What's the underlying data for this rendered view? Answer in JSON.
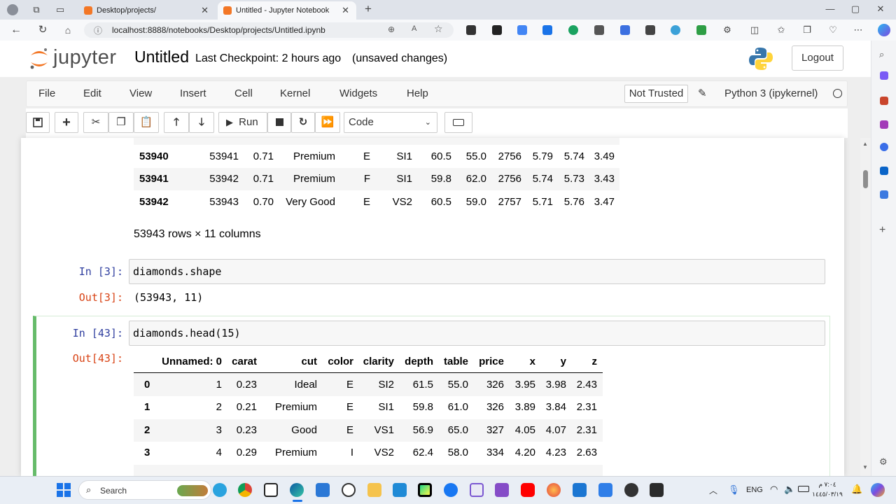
{
  "browser": {
    "tabs": [
      {
        "title": "Desktop/projects/",
        "active": false
      },
      {
        "title": "Untitled - Jupyter Notebook",
        "active": true
      }
    ],
    "url": "localhost:8888/notebooks/Desktop/projects/Untitled.ipynb"
  },
  "jupyter": {
    "logo_text": "jupyter",
    "notebook_name": "Untitled",
    "checkpoint": "Last Checkpoint: 2 hours ago",
    "unsaved": "(unsaved changes)",
    "logout_label": "Logout",
    "menu": [
      "File",
      "Edit",
      "View",
      "Insert",
      "Cell",
      "Kernel",
      "Widgets",
      "Help"
    ],
    "trust_label": "Not Trusted",
    "kernel_label": "Python 3 (ipykernel)",
    "run_label": "Run",
    "cell_type": "Code"
  },
  "cells": {
    "prev_output": {
      "rows": [
        {
          "index": "53940",
          "values": [
            "53941",
            "0.71",
            "Premium",
            "E",
            "SI1",
            "60.5",
            "55.0",
            "2756",
            "5.79",
            "5.74",
            "3.49"
          ]
        },
        {
          "index": "53941",
          "values": [
            "53942",
            "0.71",
            "Premium",
            "F",
            "SI1",
            "59.8",
            "62.0",
            "2756",
            "5.74",
            "5.73",
            "3.43"
          ]
        },
        {
          "index": "53942",
          "values": [
            "53943",
            "0.70",
            "Very Good",
            "E",
            "VS2",
            "60.5",
            "59.0",
            "2757",
            "5.71",
            "5.76",
            "3.47"
          ]
        }
      ],
      "summary": "53943 rows × 11 columns"
    },
    "cell3": {
      "in_prompt": "In [3]:",
      "code": "diamonds.shape",
      "out_prompt": "Out[3]:",
      "output": "(53943, 11)"
    },
    "cell43": {
      "in_prompt": "In [43]:",
      "code": "diamonds.head(15)",
      "out_prompt": "Out[43]:",
      "columns": [
        "Unnamed: 0",
        "carat",
        "cut",
        "color",
        "clarity",
        "depth",
        "table",
        "price",
        "x",
        "y",
        "z"
      ],
      "rows": [
        {
          "index": "0",
          "values": [
            "1",
            "0.23",
            "Ideal",
            "E",
            "SI2",
            "61.5",
            "55.0",
            "326",
            "3.95",
            "3.98",
            "2.43"
          ]
        },
        {
          "index": "1",
          "values": [
            "2",
            "0.21",
            "Premium",
            "E",
            "SI1",
            "59.8",
            "61.0",
            "326",
            "3.89",
            "3.84",
            "2.31"
          ]
        },
        {
          "index": "2",
          "values": [
            "3",
            "0.23",
            "Good",
            "E",
            "VS1",
            "56.9",
            "65.0",
            "327",
            "4.05",
            "4.07",
            "2.31"
          ]
        },
        {
          "index": "3",
          "values": [
            "4",
            "0.29",
            "Premium",
            "I",
            "VS2",
            "62.4",
            "58.0",
            "334",
            "4.20",
            "4.23",
            "2.63"
          ]
        }
      ]
    }
  },
  "taskbar": {
    "search_label": "Search",
    "lang": "ENG"
  },
  "colors": {
    "accent": "#f37726",
    "cell_selected": "#66bb6a",
    "in_prompt": "#303f9f",
    "out_prompt": "#d84315"
  }
}
